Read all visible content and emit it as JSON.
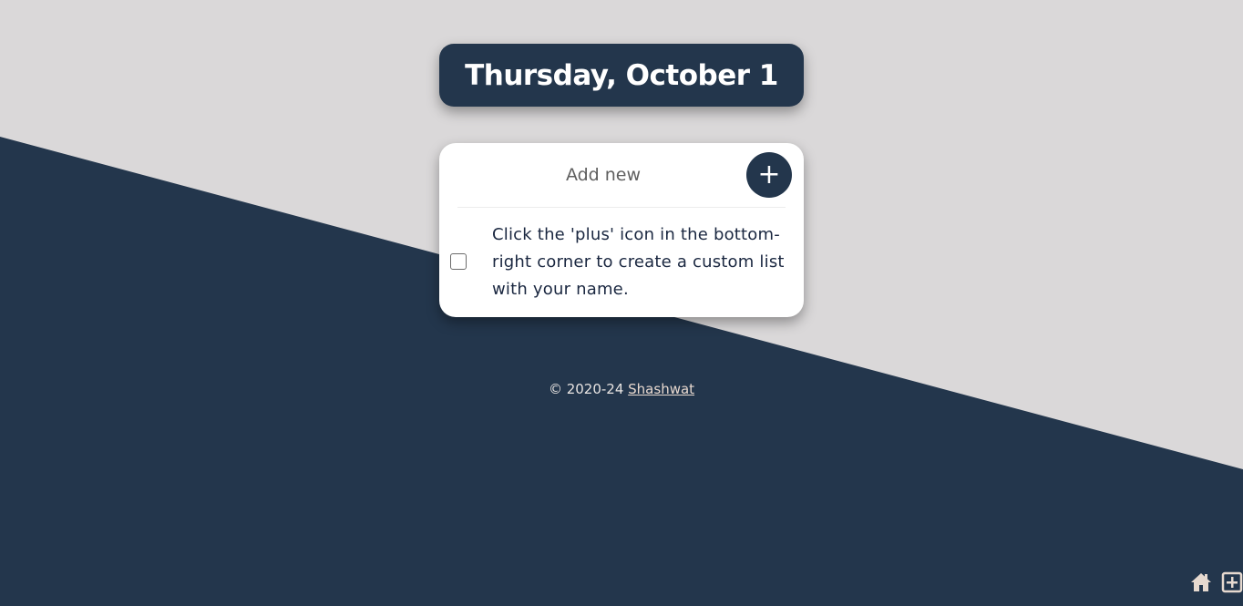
{
  "header": {
    "date": "Thursday, October 1"
  },
  "add_row": {
    "placeholder": "Add new",
    "add_button": "+"
  },
  "items": [
    {
      "text": "Click the 'plus' icon in the bottom-right corner to create a custom list with your name.",
      "checked": false
    }
  ],
  "footer": {
    "copyright": "© 2020-24 ",
    "author": "Shashwat"
  },
  "corner_icons": [
    "home-icon",
    "add-square-icon"
  ],
  "colors": {
    "page_background": "#dad8d9",
    "navy": "#23364c",
    "card": "#ffffff"
  }
}
